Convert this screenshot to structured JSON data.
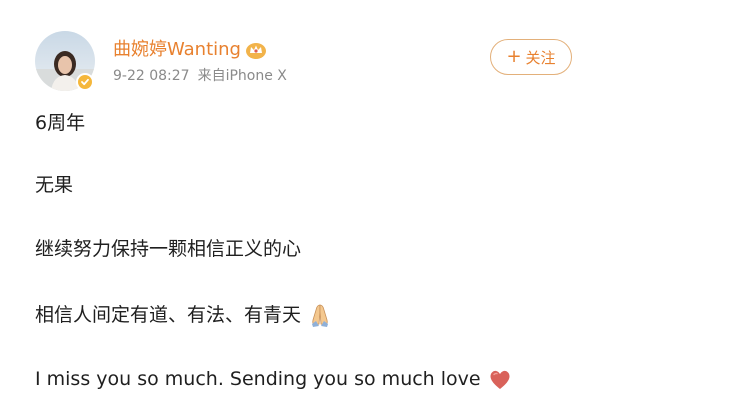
{
  "post": {
    "author": {
      "name": "曲婉婷Wanting",
      "verified": true
    },
    "meta": {
      "timestamp": "9-22 08:27",
      "source": "来自iPhone X"
    },
    "follow_button": {
      "label": "关注",
      "icon": "plus-icon"
    },
    "content": {
      "lines": [
        "6周年",
        "无果",
        "继续努力保持一颗相信正义的心",
        "相信人间定有道、有法、有青天",
        "I miss you so much. Sending you so much love"
      ],
      "emojis": {
        "line4": "folded-hands-icon",
        "line5": "heart-icon"
      }
    },
    "colors": {
      "username": "#e8812f",
      "follow_border": "#e3b07a",
      "meta_text": "#8a8a8a",
      "verified_badge": "#f5b73b"
    }
  }
}
